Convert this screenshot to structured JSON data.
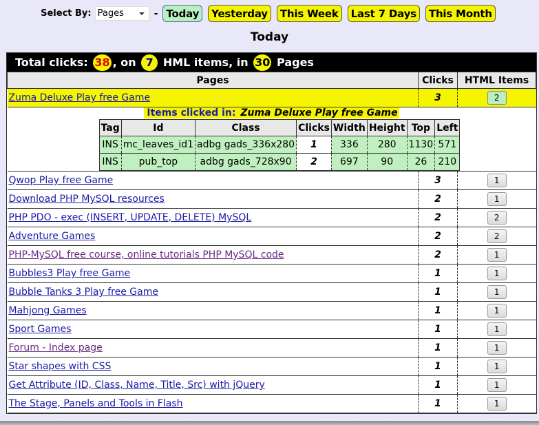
{
  "filter": {
    "label": "Select By:",
    "select_value": "Pages",
    "separator": "-",
    "periods": [
      {
        "label": "Today",
        "active": true
      },
      {
        "label": "Yesterday",
        "active": false
      },
      {
        "label": "This Week",
        "active": false
      },
      {
        "label": "Last 7 Days",
        "active": false
      },
      {
        "label": "This Month",
        "active": false
      }
    ]
  },
  "heading": "Today",
  "totals": {
    "prefix": "Total clicks:",
    "clicks": "38",
    "mid1": ", on",
    "items": "7",
    "mid2": "HML items, in",
    "pages": "30",
    "suffix": "Pages"
  },
  "table": {
    "headers": {
      "pages": "Pages",
      "clicks": "Clicks",
      "items": "HTML Items"
    },
    "rows": [
      {
        "page": "Zuma Deluxe Play free Game",
        "clicks": "3",
        "items": "2",
        "visited": false,
        "expanded": true
      },
      {
        "page": "Qwop Play free Game",
        "clicks": "3",
        "items": "1",
        "visited": false
      },
      {
        "page": "Download PHP MySQL resources",
        "clicks": "2",
        "items": "1",
        "visited": false
      },
      {
        "page": "PHP PDO - exec (INSERT, UPDATE, DELETE) MySQL",
        "clicks": "2",
        "items": "2",
        "visited": false
      },
      {
        "page": "Adventure Games",
        "clicks": "2",
        "items": "2",
        "visited": false
      },
      {
        "page": "PHP-MySQL free course, online tutorials PHP MySQL code",
        "clicks": "2",
        "items": "1",
        "visited": true
      },
      {
        "page": "Bubbles3 Play free Game",
        "clicks": "1",
        "items": "1",
        "visited": false
      },
      {
        "page": "Bubble Tanks 3 Play free Game",
        "clicks": "1",
        "items": "1",
        "visited": false
      },
      {
        "page": "Mahjong Games",
        "clicks": "1",
        "items": "1",
        "visited": false
      },
      {
        "page": "Sport Games",
        "clicks": "1",
        "items": "1",
        "visited": false
      },
      {
        "page": "Forum - Index page",
        "clicks": "1",
        "items": "1",
        "visited": true
      },
      {
        "page": "Star shapes with CSS",
        "clicks": "1",
        "items": "1",
        "visited": false
      },
      {
        "page": "Get Attribute (ID, Class, Name, Title, Src) with jQuery",
        "clicks": "1",
        "items": "1",
        "visited": false
      },
      {
        "page": "The Stage, Panels and Tools in Flash",
        "clicks": "1",
        "items": "1",
        "visited": false
      }
    ]
  },
  "detail": {
    "title_prefix": "Items clicked in:",
    "title_page": "Zuma Deluxe Play free Game",
    "headers": [
      "Tag",
      "Id",
      "Class",
      "Clicks",
      "Width",
      "Height",
      "Top",
      "Left"
    ],
    "rows": [
      [
        "INS",
        "mc_leaves_id1",
        "adbg gads_336x280",
        "1",
        "336",
        "280",
        "1130",
        "571"
      ],
      [
        "INS",
        "pub_top",
        "adbg gads_728x90",
        "2",
        "697",
        "90",
        "26",
        "210"
      ]
    ]
  },
  "colors": {
    "yellow": "#f5f500",
    "active_green": "#b8eec0",
    "link": "#1a1aa6",
    "visited": "#6a2a80",
    "count_red": "#e00000"
  }
}
